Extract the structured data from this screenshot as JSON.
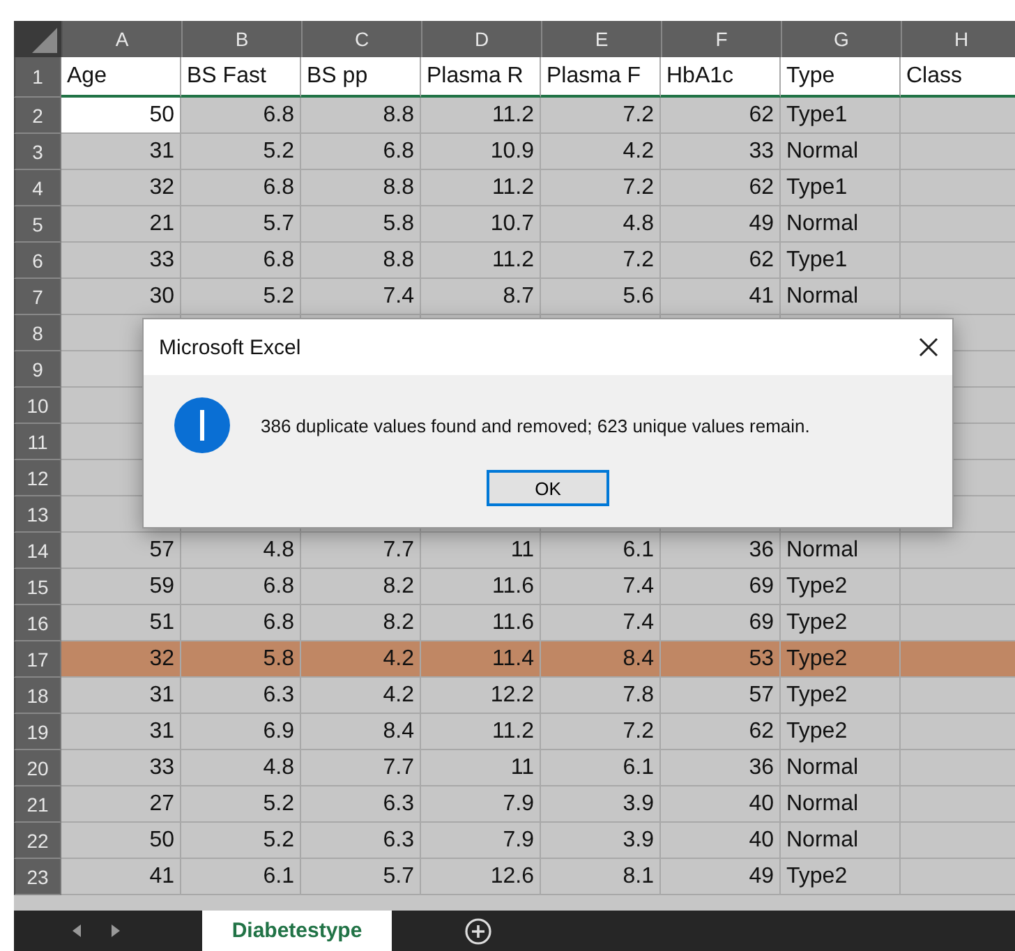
{
  "column_headers": [
    "A",
    "B",
    "C",
    "D",
    "E",
    "F",
    "G",
    "H"
  ],
  "header_row": {
    "number": "1",
    "cells": [
      "Age",
      "BS Fast",
      "BS pp",
      "Plasma R",
      "Plasma F",
      "HbA1c",
      "Type",
      "Class"
    ]
  },
  "rows": [
    {
      "number": "2",
      "active": true,
      "highlighted": false,
      "cells": [
        "50",
        "6.8",
        "8.8",
        "11.2",
        "7.2",
        "62",
        "Type1"
      ]
    },
    {
      "number": "3",
      "active": false,
      "highlighted": false,
      "cells": [
        "31",
        "5.2",
        "6.8",
        "10.9",
        "4.2",
        "33",
        "Normal"
      ]
    },
    {
      "number": "4",
      "active": false,
      "highlighted": false,
      "cells": [
        "32",
        "6.8",
        "8.8",
        "11.2",
        "7.2",
        "62",
        "Type1"
      ]
    },
    {
      "number": "5",
      "active": false,
      "highlighted": false,
      "cells": [
        "21",
        "5.7",
        "5.8",
        "10.7",
        "4.8",
        "49",
        "Normal"
      ]
    },
    {
      "number": "6",
      "active": false,
      "highlighted": false,
      "cells": [
        "33",
        "6.8",
        "8.8",
        "11.2",
        "7.2",
        "62",
        "Type1"
      ]
    },
    {
      "number": "7",
      "active": false,
      "highlighted": false,
      "cells": [
        "30",
        "5.2",
        "7.4",
        "8.7",
        "5.6",
        "41",
        "Normal"
      ]
    },
    {
      "number": "8",
      "active": false,
      "highlighted": false
    },
    {
      "number": "9",
      "active": false,
      "highlighted": false
    },
    {
      "number": "10",
      "active": false,
      "highlighted": false
    },
    {
      "number": "11",
      "active": false,
      "highlighted": false
    },
    {
      "number": "12",
      "active": false,
      "highlighted": false
    },
    {
      "number": "13",
      "active": false,
      "highlighted": false
    },
    {
      "number": "14",
      "active": false,
      "highlighted": false,
      "cells": [
        "57",
        "4.8",
        "7.7",
        "11",
        "6.1",
        "36",
        "Normal"
      ]
    },
    {
      "number": "15",
      "active": false,
      "highlighted": false,
      "cells": [
        "59",
        "6.8",
        "8.2",
        "11.6",
        "7.4",
        "69",
        "Type2"
      ]
    },
    {
      "number": "16",
      "active": false,
      "highlighted": false,
      "cells": [
        "51",
        "6.8",
        "8.2",
        "11.6",
        "7.4",
        "69",
        "Type2"
      ]
    },
    {
      "number": "17",
      "active": false,
      "highlighted": true,
      "cells": [
        "32",
        "5.8",
        "4.2",
        "11.4",
        "8.4",
        "53",
        "Type2"
      ]
    },
    {
      "number": "18",
      "active": false,
      "highlighted": false,
      "cells": [
        "31",
        "6.3",
        "4.2",
        "12.2",
        "7.8",
        "57",
        "Type2"
      ]
    },
    {
      "number": "19",
      "active": false,
      "highlighted": false,
      "cells": [
        "31",
        "6.9",
        "8.4",
        "11.2",
        "7.2",
        "62",
        "Type2"
      ]
    },
    {
      "number": "20",
      "active": false,
      "highlighted": false,
      "cells": [
        "33",
        "4.8",
        "7.7",
        "11",
        "6.1",
        "36",
        "Normal"
      ]
    },
    {
      "number": "21",
      "active": false,
      "highlighted": false,
      "cells": [
        "27",
        "5.2",
        "6.3",
        "7.9",
        "3.9",
        "40",
        "Normal"
      ]
    },
    {
      "number": "22",
      "active": false,
      "highlighted": false,
      "cells": [
        "50",
        "5.2",
        "6.3",
        "7.9",
        "3.9",
        "40",
        "Normal"
      ]
    },
    {
      "number": "23",
      "active": false,
      "highlighted": false,
      "cells": [
        "41",
        "6.1",
        "5.7",
        "12.6",
        "8.1",
        "49",
        "Type2"
      ]
    }
  ],
  "sheet_tabs": [
    {
      "label": "Diabetestype",
      "selected": true
    }
  ],
  "dialog": {
    "title": "Microsoft Excel",
    "message": "386 duplicate values found and removed; 623 unique values remain.",
    "button": "OK"
  }
}
